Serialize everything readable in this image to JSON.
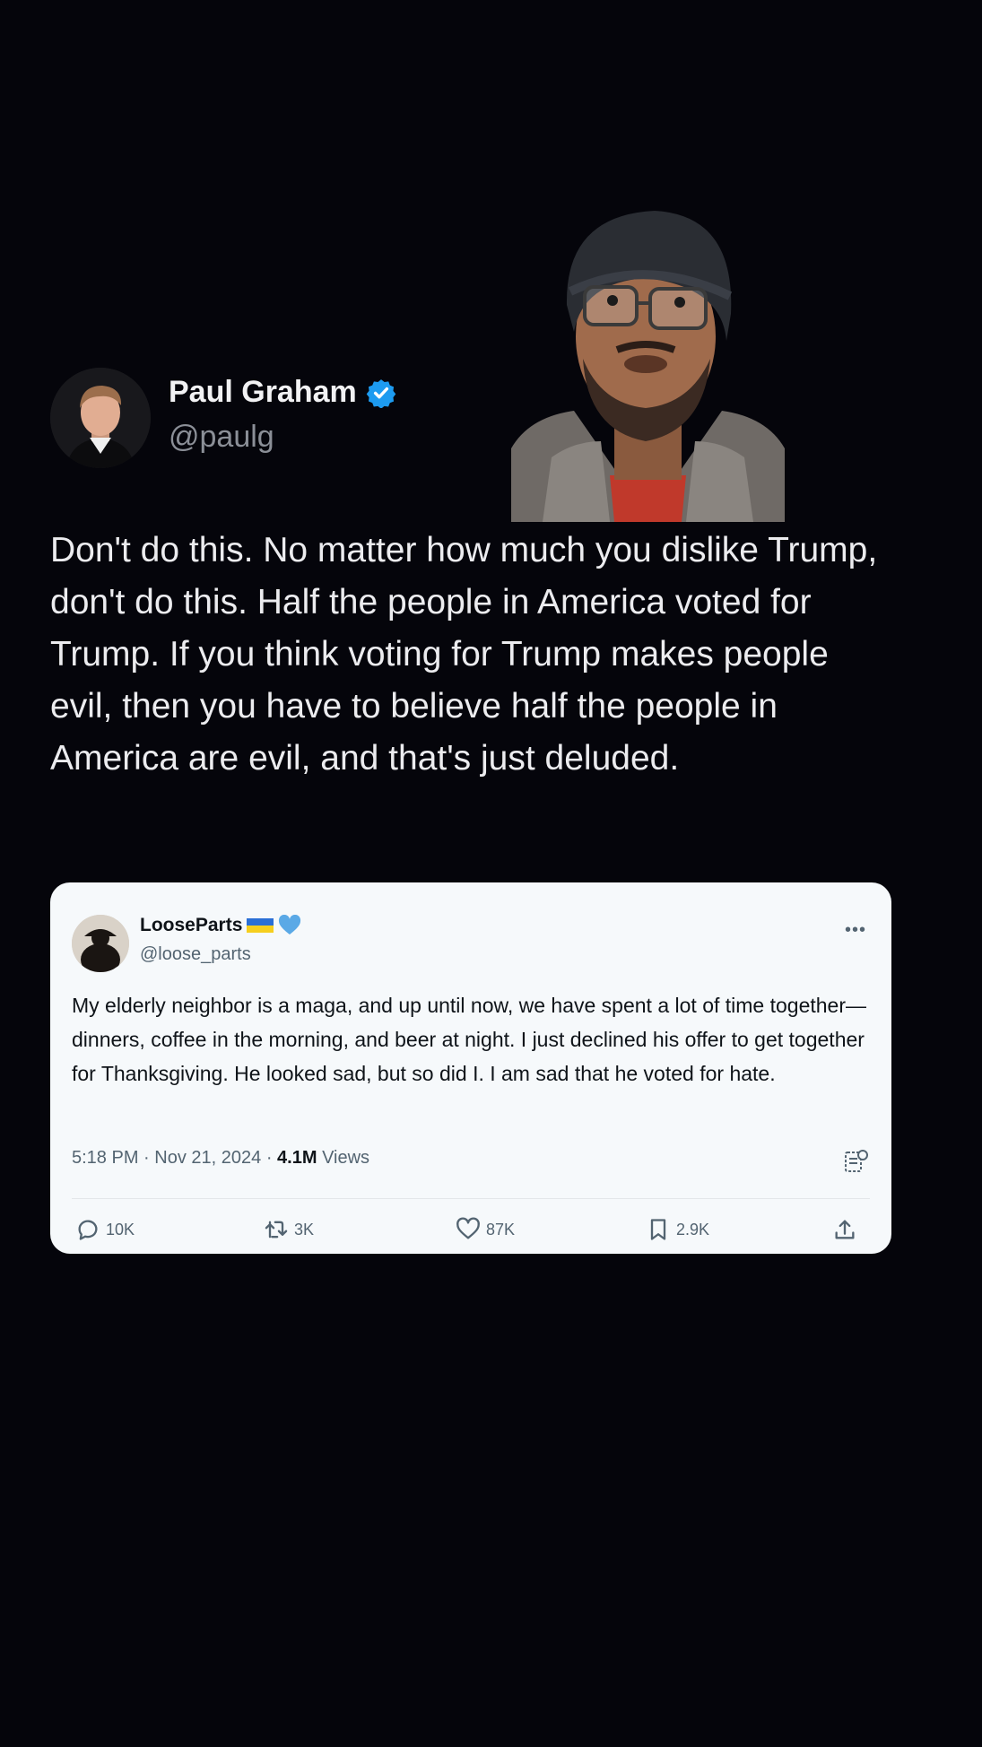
{
  "main_tweet": {
    "author": {
      "name": "Paul Graham",
      "handle": "@paulg",
      "verified": true,
      "verified_color": "#1d9bf0"
    },
    "text": "Don't do this. No matter how much you dislike Trump, don't do this. Half the people in America voted for Trump. If you think voting for Trump makes people evil, then you have to believe half the people in America are evil, and that's just deluded."
  },
  "quoted_tweet": {
    "author": {
      "name": "LooseParts",
      "handle": "@loose_parts",
      "flag": "ukraine-flag",
      "heart": "blue-heart"
    },
    "text": "My elderly neighbor is a maga, and up until now, we have spent a lot of time together—dinners, coffee in the morning, and beer at night. I just declined his offer to get together for Thanksgiving. He looked sad, but so did I. I am sad that he voted for hate.",
    "meta": {
      "time": "5:18 PM",
      "date": "Nov 21, 2024",
      "views_count": "4.1M",
      "views_label": "Views"
    },
    "actions": {
      "replies": "10K",
      "reposts": "3K",
      "likes": "87K",
      "bookmarks": "2.9K"
    }
  },
  "colors": {
    "background": "#05050b",
    "card_background": "#f6f9fb",
    "accent": "#1d9bf0"
  }
}
